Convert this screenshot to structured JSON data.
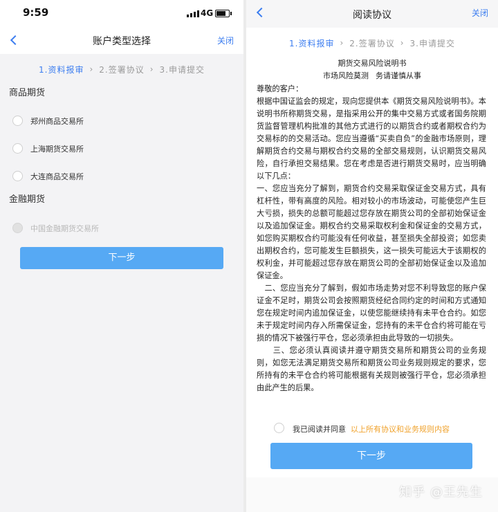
{
  "status_bar": {
    "time": "9:59",
    "network": "4G",
    "icons": [
      "signal-icon",
      "battery-icon"
    ]
  },
  "colors": {
    "accent": "#3d7ef0",
    "button": "#56a9f4",
    "link_orange": "#f0a22c",
    "background": "#f3f3f5"
  },
  "left_screen": {
    "nav": {
      "back_icon": "chevron-left-icon",
      "title": "账户类型选择",
      "close": "关闭"
    },
    "steps": [
      {
        "label": "1.资料报审",
        "active": true
      },
      {
        "label": "2.签署协议",
        "active": false
      },
      {
        "label": "3.申请提交",
        "active": false
      }
    ],
    "sections": [
      {
        "header": "商品期货",
        "options": [
          {
            "label": "郑州商品交易所",
            "disabled": false
          },
          {
            "label": "上海期货交易所",
            "disabled": false
          },
          {
            "label": "大连商品交易所",
            "disabled": false
          }
        ]
      },
      {
        "header": "金融期货",
        "options": [
          {
            "label": "中国金融期货交易所",
            "disabled": true
          }
        ]
      }
    ],
    "next_button": "下一步"
  },
  "right_screen": {
    "nav": {
      "back_icon": "chevron-left-icon",
      "title": "阅读协议",
      "close": "关闭"
    },
    "steps": [
      {
        "label": "1.资料报审",
        "active": true
      },
      {
        "label": "2.签署协议",
        "active": false
      },
      {
        "label": "3.申请提交",
        "active": false
      }
    ],
    "doc_title": "期货交易风险说明书",
    "doc_subtitle": [
      "市场风险莫测",
      "务请谨慎从事"
    ],
    "doc_paragraphs": [
      "尊敬的客户：",
      "根据中国证监会的规定，现向您提供本《期货交易风险说明书》。本说明书所称期货交易，是指采用公开的集中交易方式或者国务院期货监督管理机构批准的其他方式进行的以期货合约或者期权合约为交易标的的交易活动。您应当遵循“买卖自负”的金融市场原则，理解期货合约交易与期权合约交易的全部交易规则，认识期货交易风险，自行承担交易结果。您在考虑是否进行期货交易时，应当明确以下几点：",
      "一、您应当充分了解到，期货合约交易采取保证金交易方式，具有杠杆性，带有高度的风险。相对较小的市场波动，可能使您产生巨大亏损，损失的总额可能超过您存放在期货公司的全部初始保证金以及追加保证金。期权合约交易采取权利金和保证金的交易方式，如您购买期权合约可能没有任何收益，甚至损失全部投资；如您卖出期权合约，您可能发生巨额损失，这一损失可能远大于该期权的权利金，并可能超过您存放在期货公司的全部初始保证金以及追加保证金。",
      "　二、您应当充分了解到，假如市场走势对您不利导致您的账户保证金不足时，期货公司会按照期货经纪合同约定的时间和方式通知您在规定时间内追加保证金，以使您能继续持有未平仓合约。如您未于规定时间内存入所需保证金，您持有的未平仓合约将可能在亏损的情况下被强行平仓，您必须承担由此导致的一切损失。",
      "　　三、您必须认真阅读并遵守期货交易所和期货公司的业务规则，如您无法满足期货交易所和期货公司业务规则规定的要求，您所持有的未平仓合约将可能根据有关规则被强行平仓，您必须承担由此产生的后果。"
    ],
    "agree_text": "我已阅读并同意",
    "agree_link": "以上所有协议和业务规则内容",
    "next_button": "下一步"
  },
  "watermark": "知乎 @王先生"
}
